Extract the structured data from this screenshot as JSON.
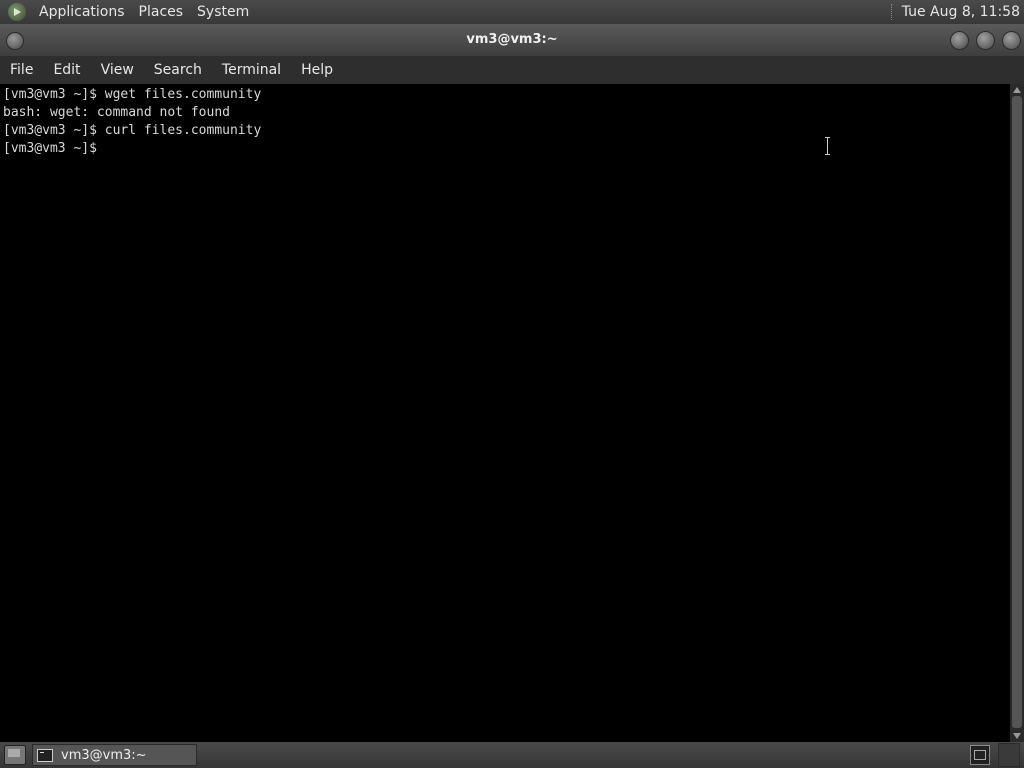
{
  "top_panel": {
    "menus": [
      "Applications",
      "Places",
      "System"
    ],
    "clock": "Tue Aug  8, 11:58"
  },
  "window": {
    "title": "vm3@vm3:~"
  },
  "menubar": {
    "items": [
      "File",
      "Edit",
      "View",
      "Search",
      "Terminal",
      "Help"
    ]
  },
  "terminal": {
    "lines": [
      "[vm3@vm3 ~]$ wget files.community",
      "bash: wget: command not found",
      "[vm3@vm3 ~]$ curl files.community",
      "[vm3@vm3 ~]$ "
    ]
  },
  "taskbar": {
    "task_label": "vm3@vm3:~"
  }
}
